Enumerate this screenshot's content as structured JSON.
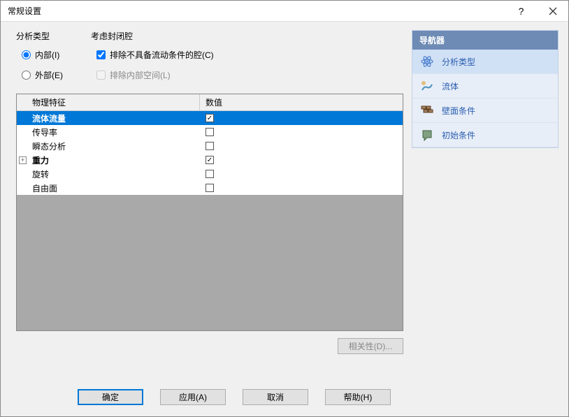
{
  "window": {
    "title": "常规设置"
  },
  "analysis_type": {
    "legend": "分析类型",
    "internal": "内部(I)",
    "external": "外部(E)"
  },
  "cavity": {
    "legend": "考虑封闭腔",
    "exclude_no_flow": "排除不具备流动条件的腔(C)",
    "exclude_internal": "排除内部空间(L)"
  },
  "table": {
    "col1": "物理特征",
    "col2": "数值",
    "rows": [
      {
        "name": "流体流量",
        "checked": true,
        "selected": true
      },
      {
        "name": "传导率",
        "checked": false
      },
      {
        "name": "瞬态分析",
        "checked": false
      },
      {
        "name": "重力",
        "checked": true,
        "expandable": true
      },
      {
        "name": "旋转",
        "checked": false
      },
      {
        "name": "自由面",
        "checked": false
      }
    ]
  },
  "dependency_btn": "相关性(D)...",
  "navigator": {
    "header": "导航器",
    "items": [
      {
        "label": "分析类型",
        "active": true,
        "icon": "atom"
      },
      {
        "label": "流体",
        "icon": "fluid"
      },
      {
        "label": "壁面条件",
        "icon": "wall"
      },
      {
        "label": "初始条件",
        "icon": "init"
      }
    ]
  },
  "footer": {
    "ok": "确定",
    "apply": "应用(A)",
    "cancel": "取消",
    "help": "帮助(H)"
  }
}
